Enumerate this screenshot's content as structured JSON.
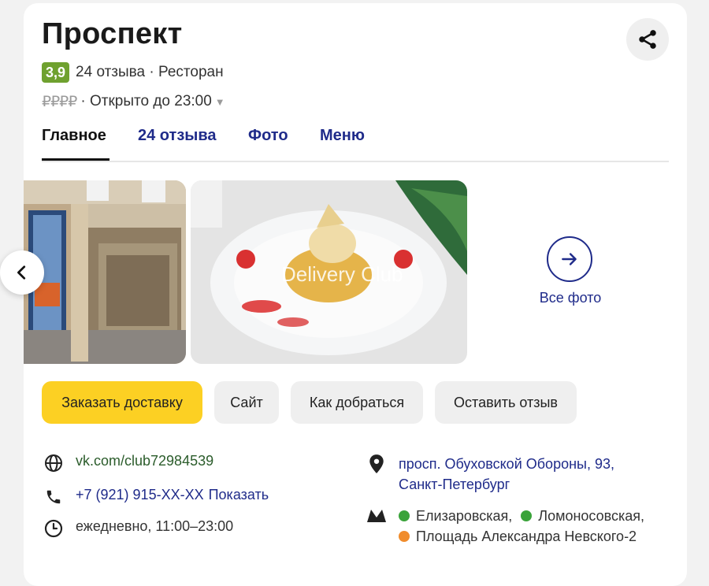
{
  "place": {
    "title": "Проспект",
    "rating": "3,9",
    "rating_color": "#6fa12f",
    "reviews_category": "24 отзыва · Ресторан",
    "price_level": "₽₽₽₽",
    "open_status": "· Открыто до 23:00",
    "share_icon": "share-icon"
  },
  "tabs": [
    {
      "label": "Главное",
      "active": true
    },
    {
      "label": "24 отзыва",
      "active": false
    },
    {
      "label": "Фото",
      "active": false
    },
    {
      "label": "Меню",
      "active": false
    }
  ],
  "gallery": {
    "watermark": "Delivery Club",
    "all_photos_label": "Все фото"
  },
  "actions": {
    "order_delivery": "Заказать доставку",
    "site": "Сайт",
    "directions": "Как добраться",
    "review": "Оставить отзыв",
    "accent_color": "#fcd023"
  },
  "contacts": {
    "website": "vk.com/club72984539",
    "phone": "+7 (921) 915-XX-XX",
    "phone_show": "Показать",
    "hours": "ежедневно, 11:00–23:00",
    "address_line1": "просп. Обуховской Обороны, 93,",
    "address_line2": "Санкт-Петербург",
    "metro": [
      {
        "name": "Елизаровская,",
        "color": "#3aa33a"
      },
      {
        "name": "Ломоносовская,",
        "color": "#3aa33a"
      },
      {
        "name": "Площадь Александра Невского-2",
        "color": "#f08c2c"
      }
    ]
  }
}
